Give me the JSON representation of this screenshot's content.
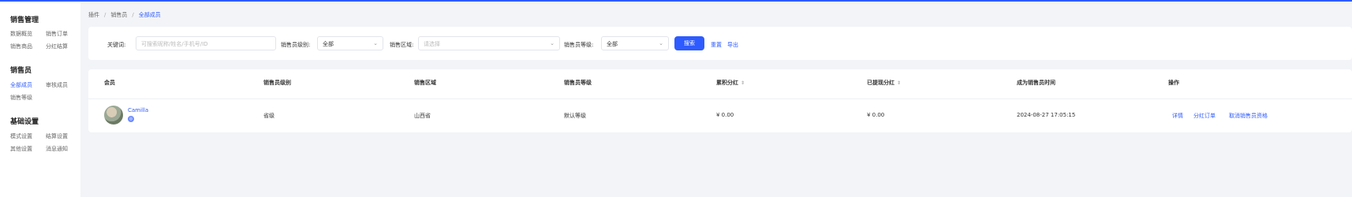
{
  "sidebar": {
    "groups": [
      {
        "title": "销售管理",
        "items": [
          "数据概览",
          "销售订单",
          "销售商品",
          "分红结算"
        ]
      },
      {
        "title": "销售员",
        "items": [
          "全部成员",
          "审核成员",
          "销售等级"
        ]
      },
      {
        "title": "基础设置",
        "items": [
          "模式设置",
          "结算设置",
          "其他设置",
          "消息通知"
        ]
      }
    ]
  },
  "breadcrumb": [
    "插件",
    "销售员",
    "全部成员"
  ],
  "filters": {
    "keyword_label": "关键词:",
    "keyword_placeholder": "可搜索昵称/姓名/手机号/ID",
    "level_label": "销售员级别:",
    "level_value": "全部",
    "region_label": "销售区域:",
    "region_placeholder": "请选择",
    "grade_label": "销售员等级:",
    "grade_value": "全部",
    "search_button": "搜索",
    "reset_link": "重置",
    "export_link": "导出"
  },
  "table": {
    "columns": [
      "会员",
      "销售员级别",
      "销售区域",
      "销售员等级",
      "累积分红",
      "已提现分红",
      "成为销售员时间",
      "操作"
    ],
    "rows": [
      {
        "member": "Camilla",
        "level": "省级",
        "region": "山西省",
        "grade": "默认等级",
        "total_dividend": "¥ 0.00",
        "withdrawn_dividend": "¥ 0.00",
        "joined_at": "2024-08-27 17:05:15",
        "actions": [
          "详情",
          "分红订单",
          "取消销售员资格"
        ]
      }
    ]
  },
  "colors": {
    "accent": "#2e5bff",
    "background": "#f3f4f7"
  }
}
